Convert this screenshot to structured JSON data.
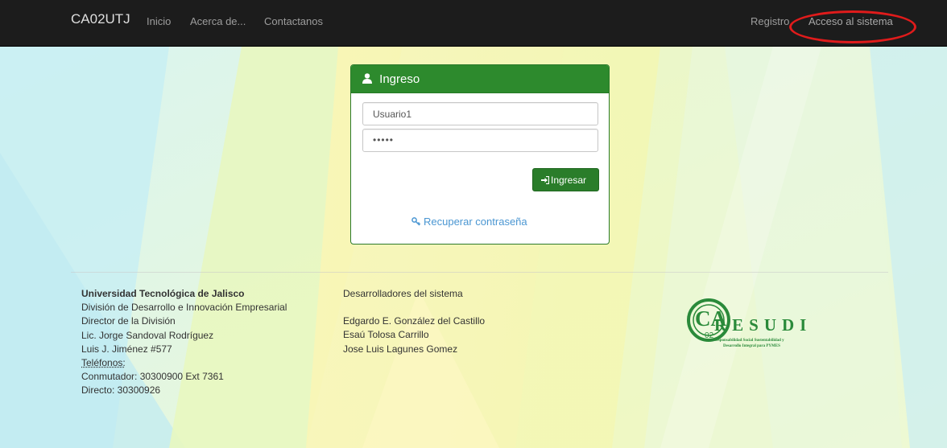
{
  "navbar": {
    "brand": "CA02UTJ",
    "links": [
      "Inicio",
      "Acerca de...",
      "Contactanos"
    ],
    "right_links": [
      "Registro",
      "Acceso al sistema"
    ]
  },
  "login": {
    "title": "Ingreso",
    "username_value": "Usuario1",
    "password_value": "•••••",
    "submit_label": "Ingresar",
    "recover_label": "Recuperar contraseña"
  },
  "footer": {
    "university": {
      "name": "Universidad Tecnológica de Jalisco",
      "lines": [
        "División de Desarrollo e Innovación Empresarial",
        "Director de la División",
        "Lic. Jorge Sandoval Rodríguez",
        "Luis J. Jiménez #577",
        "Teléfonos:",
        "Conmutador: 30300900 Ext 7361",
        "Directo: 30300926"
      ]
    },
    "developers": {
      "heading": "Desarrolladores del sistema",
      "names": [
        "Edgardo E. González del Castillo",
        "Esaú Tolosa Carrillo",
        "Jose Luis Lagunes Gomez"
      ]
    },
    "logo": {
      "text_ca": "CA",
      "text_sub": "02",
      "text_resudi": "RESUDI",
      "tagline_1": "Responsabilidad Social Sustentabilidad y",
      "tagline_2": "Desarrollo Integral para PYMES"
    }
  },
  "colors": {
    "navbar_bg": "#1c1c1c",
    "panel_header": "#2d8a2d",
    "button": "#2a7d2a",
    "link": "#4a96d2",
    "highlight_ellipse": "#e01b1b",
    "logo_green": "#2a8a3a"
  },
  "icons": {
    "user": "user-icon",
    "signin": "sign-in-icon",
    "key": "key-icon"
  }
}
